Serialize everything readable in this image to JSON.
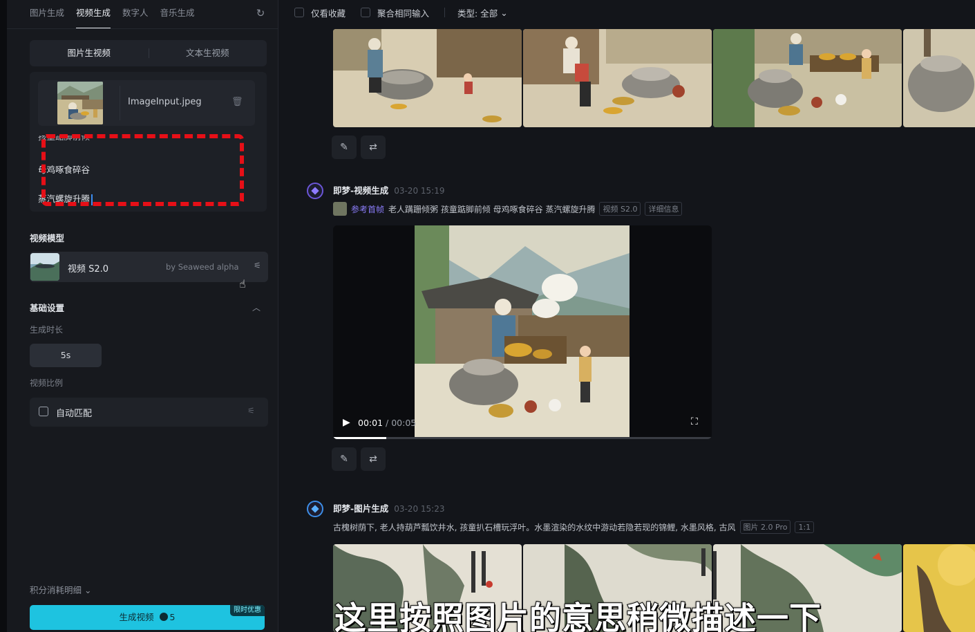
{
  "left_panel": {
    "top_tabs": [
      "图片生成",
      "视频生成",
      "数字人",
      "音乐生成"
    ],
    "active_tab": "视频生成",
    "mode_tabs": [
      "图片生视频",
      "文本生视频"
    ],
    "file_name": "ImageInput.jpeg",
    "prompt_lines": [
      "孩童踮脚前倾",
      "母鸡啄食碎谷",
      "蒸汽螺旋升腾"
    ],
    "model_section_title": "视频模型",
    "model_name": "视频 S2.0",
    "model_by": "by Seaweed alpha",
    "basic_settings_title": "基础设置",
    "duration_label": "生成时长",
    "duration_value": "5s",
    "ratio_label": "视频比例",
    "ratio_value": "自动匹配",
    "credits_label": "积分消耗明细",
    "generate_label": "生成视频",
    "generate_cost": "5",
    "promo_badge": "限时优惠"
  },
  "filter_bar": {
    "favorites_only": "仅看收藏",
    "merge_same_input": "聚合相同输入",
    "type_filter": "类型: 全部"
  },
  "entries": [
    {
      "title": "即梦-视频生成",
      "time": "03-20  15:19",
      "ref_label": "参考首帧",
      "prompt": "老人蹒跚倾粥 孩童踮脚前倾 母鸡啄食碎谷 蒸汽螺旋升腾",
      "tags": [
        "视频 S2.0",
        "详细信息"
      ],
      "video_current_time": "00:01",
      "video_duration": "/ 00:05",
      "video_progress": 0.14
    },
    {
      "title": "即梦-图片生成",
      "time": "03-20  15:23",
      "prompt": "古槐树荫下, 老人持葫芦瓢饮井水, 孩童扒石槽玩浮叶。水墨渲染的水纹中游动若隐若现的锦鲤, 水墨风格, 古风",
      "tags": [
        "图片 2.0 Pro",
        "1:1"
      ]
    }
  ],
  "subtitle_caption": "这里按照图片的意思稍微描述一下",
  "colors": {
    "accent_cyan": "#1ec3e0",
    "annotation_red": "#e60f17",
    "ref_purple": "#8a7cf8"
  }
}
